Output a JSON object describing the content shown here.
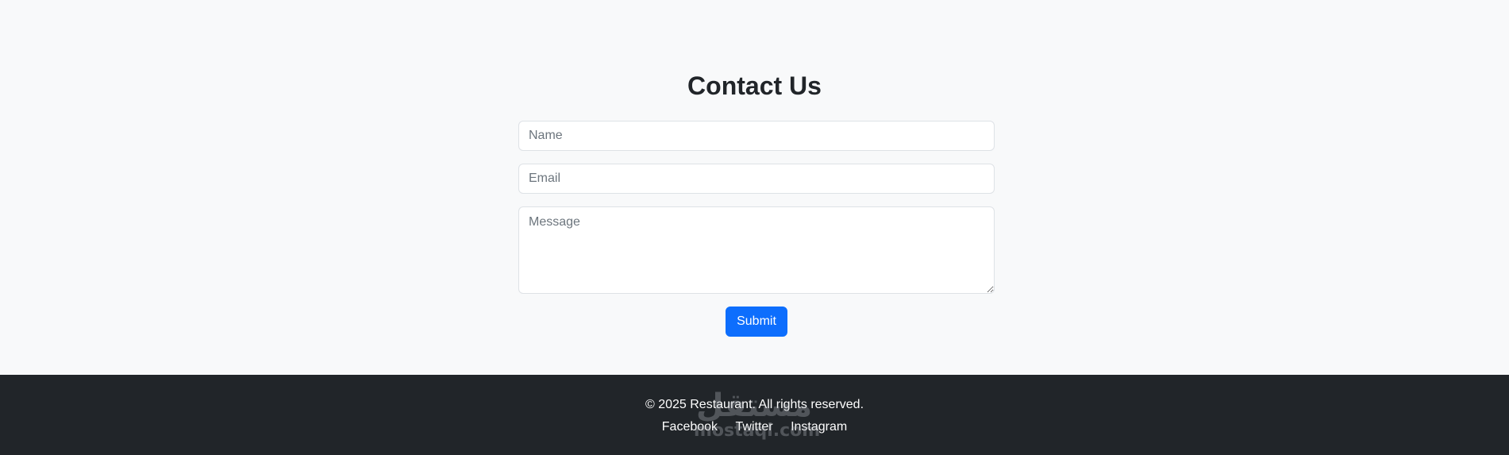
{
  "contact": {
    "title": "Contact Us",
    "name_placeholder": "Name",
    "email_placeholder": "Email",
    "message_placeholder": "Message",
    "submit_label": "Submit"
  },
  "footer": {
    "copyright": "© 2025 Restaurant. All rights reserved.",
    "links": [
      "Facebook",
      "Twitter",
      "Instagram"
    ]
  },
  "watermark": {
    "logo": "مستقل",
    "text": "mostaql.com"
  },
  "colors": {
    "page_background": "#f8f9fa",
    "primary": "#0d6efd",
    "footer_background": "#212529",
    "text": "#212529"
  }
}
